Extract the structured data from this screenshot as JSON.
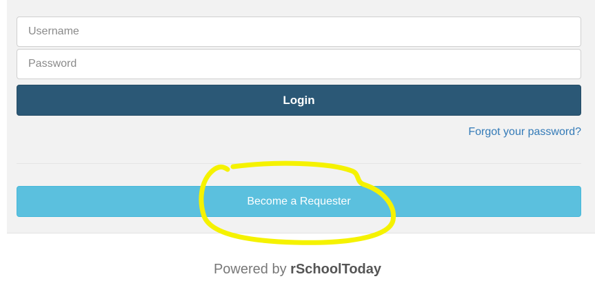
{
  "login_form": {
    "username_placeholder": "Username",
    "password_placeholder": "Password",
    "login_label": "Login",
    "forgot_password_label": "Forgot your password?",
    "become_requester_label": "Become a Requester"
  },
  "annotation": {
    "highlight_color": "#f5f200"
  },
  "footer": {
    "powered_by_prefix": "Powered by",
    "brand_name": "rSchoolToday"
  },
  "colors": {
    "login_button": "#2b5876",
    "requester_button": "#5bc0de",
    "link": "#337ab7"
  }
}
